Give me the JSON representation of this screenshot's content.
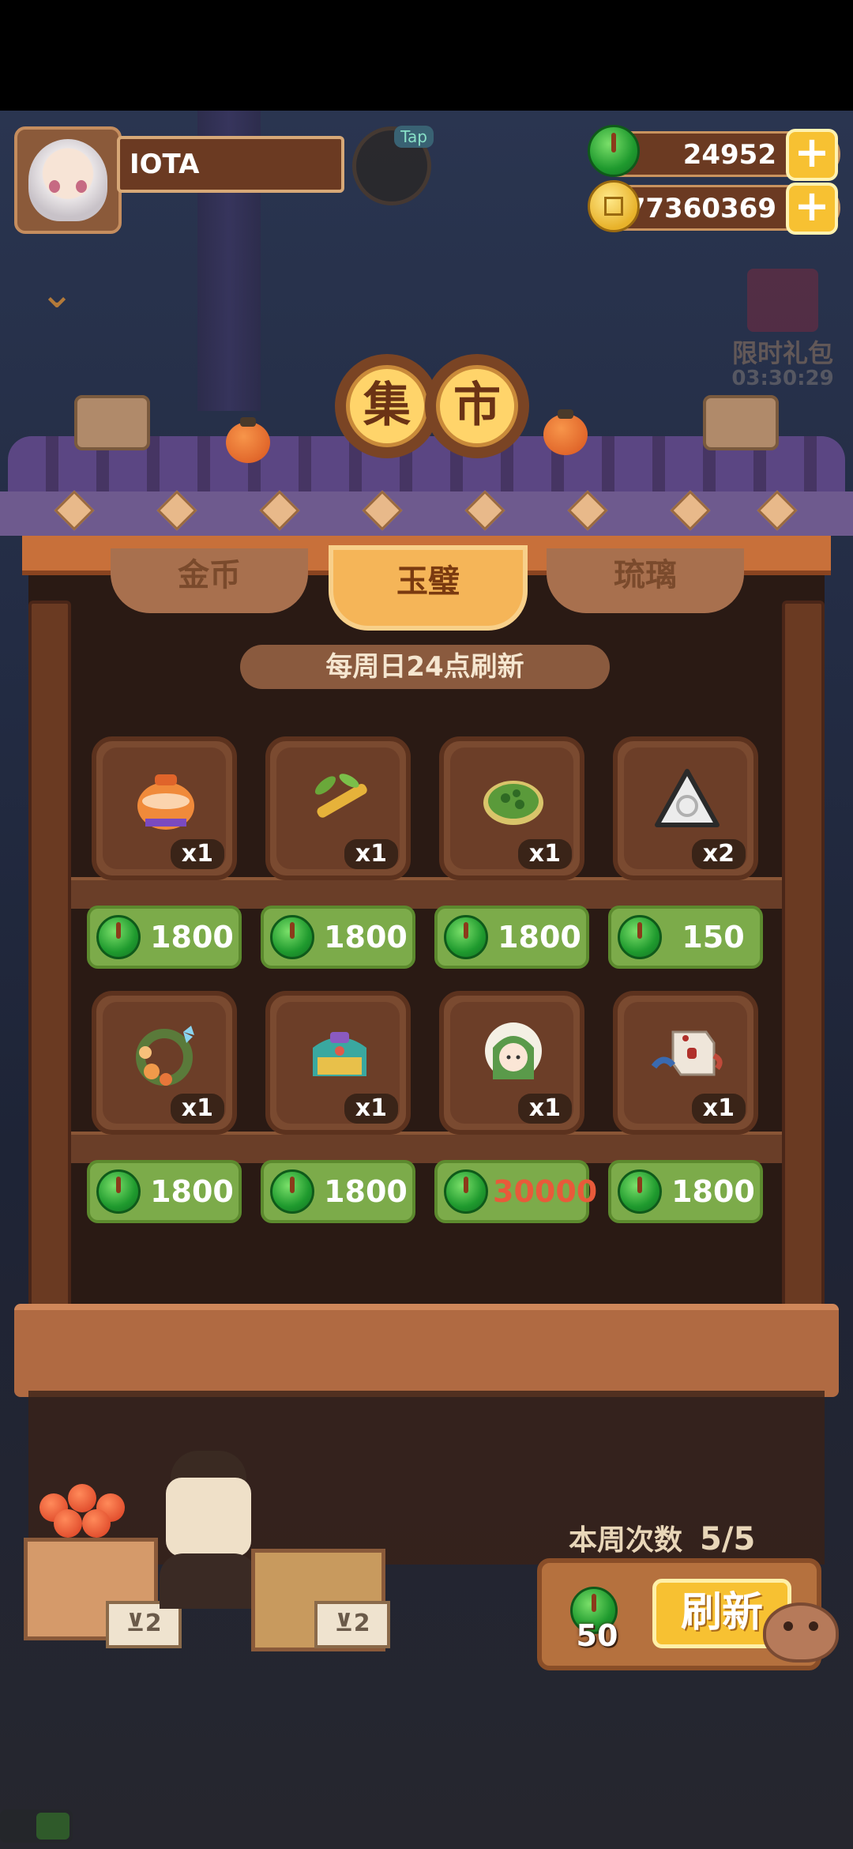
{
  "player": {
    "name": "IOTA",
    "tap_label": "Tap"
  },
  "resources": {
    "jade": {
      "value": "24952",
      "add_label": "+"
    },
    "coins": {
      "value": "77360369",
      "add_label": "+"
    }
  },
  "limited_gift": {
    "label": "限时礼包",
    "timer": "03:30:29"
  },
  "market": {
    "title_chars": [
      "集",
      "市"
    ],
    "tabs": [
      {
        "label": "金币",
        "active": false
      },
      {
        "label": "玉璧",
        "active": true
      },
      {
        "label": "琉璃",
        "active": false
      }
    ],
    "refresh_note": "每周日24点刷新",
    "items": [
      {
        "icon": "pot-icon",
        "qty": "x1",
        "price": "1800"
      },
      {
        "icon": "bamboo-icon",
        "qty": "x1",
        "price": "1800"
      },
      {
        "icon": "green-cake-icon",
        "qty": "x1",
        "price": "1800"
      },
      {
        "icon": "triangle-token-icon",
        "qty": "x2",
        "price": "150"
      },
      {
        "icon": "flower-wreath-icon",
        "qty": "x1",
        "price": "1800"
      },
      {
        "icon": "ornate-comb-icon",
        "qty": "x1",
        "price": "1800"
      },
      {
        "icon": "character-doll-icon",
        "qty": "x1",
        "price": "30000"
      },
      {
        "icon": "dice-icon",
        "qty": "x1",
        "price": "1800"
      }
    ],
    "stall_signs": [
      "⊻2",
      "⊻2"
    ],
    "weekly_label": "本周次数",
    "weekly_count": "5/5",
    "refresh_cost": "50",
    "refresh_button": "刷新"
  },
  "colors": {
    "jade": "#1f9a2e",
    "price_bg": "#7cab4a",
    "button_gold": "#f7c132",
    "price_alert": "#e85a3a"
  }
}
